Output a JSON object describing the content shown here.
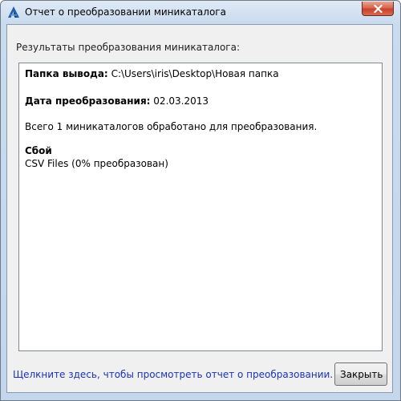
{
  "window": {
    "title": "Отчет о преобразовании миникаталога",
    "app_icon": "autocad-a-icon",
    "close_icon": "close-x-icon"
  },
  "main": {
    "header_label": "Результаты преобразования миникаталога:",
    "report": {
      "output_folder_label": "Папка вывода:",
      "output_folder_value": "C:\\Users\\iris\\Desktop\\Новая папка",
      "conversion_date_label": "Дата преобразования:",
      "conversion_date_value": "02.03.2013",
      "summary": "Всего 1 миникаталогов обработано для преобразования.",
      "failure_label": "Сбой",
      "failure_item": "CSV Files (0% преобразован)"
    }
  },
  "footer": {
    "link_text": "Щелкните здесь, чтобы просмотреть отчет о преобразовании.",
    "close_button_label": "Закрыть"
  },
  "colors": {
    "link": "#1a33b8",
    "close_button_red": "#c7422a",
    "title_bar": "#c9dbef"
  }
}
